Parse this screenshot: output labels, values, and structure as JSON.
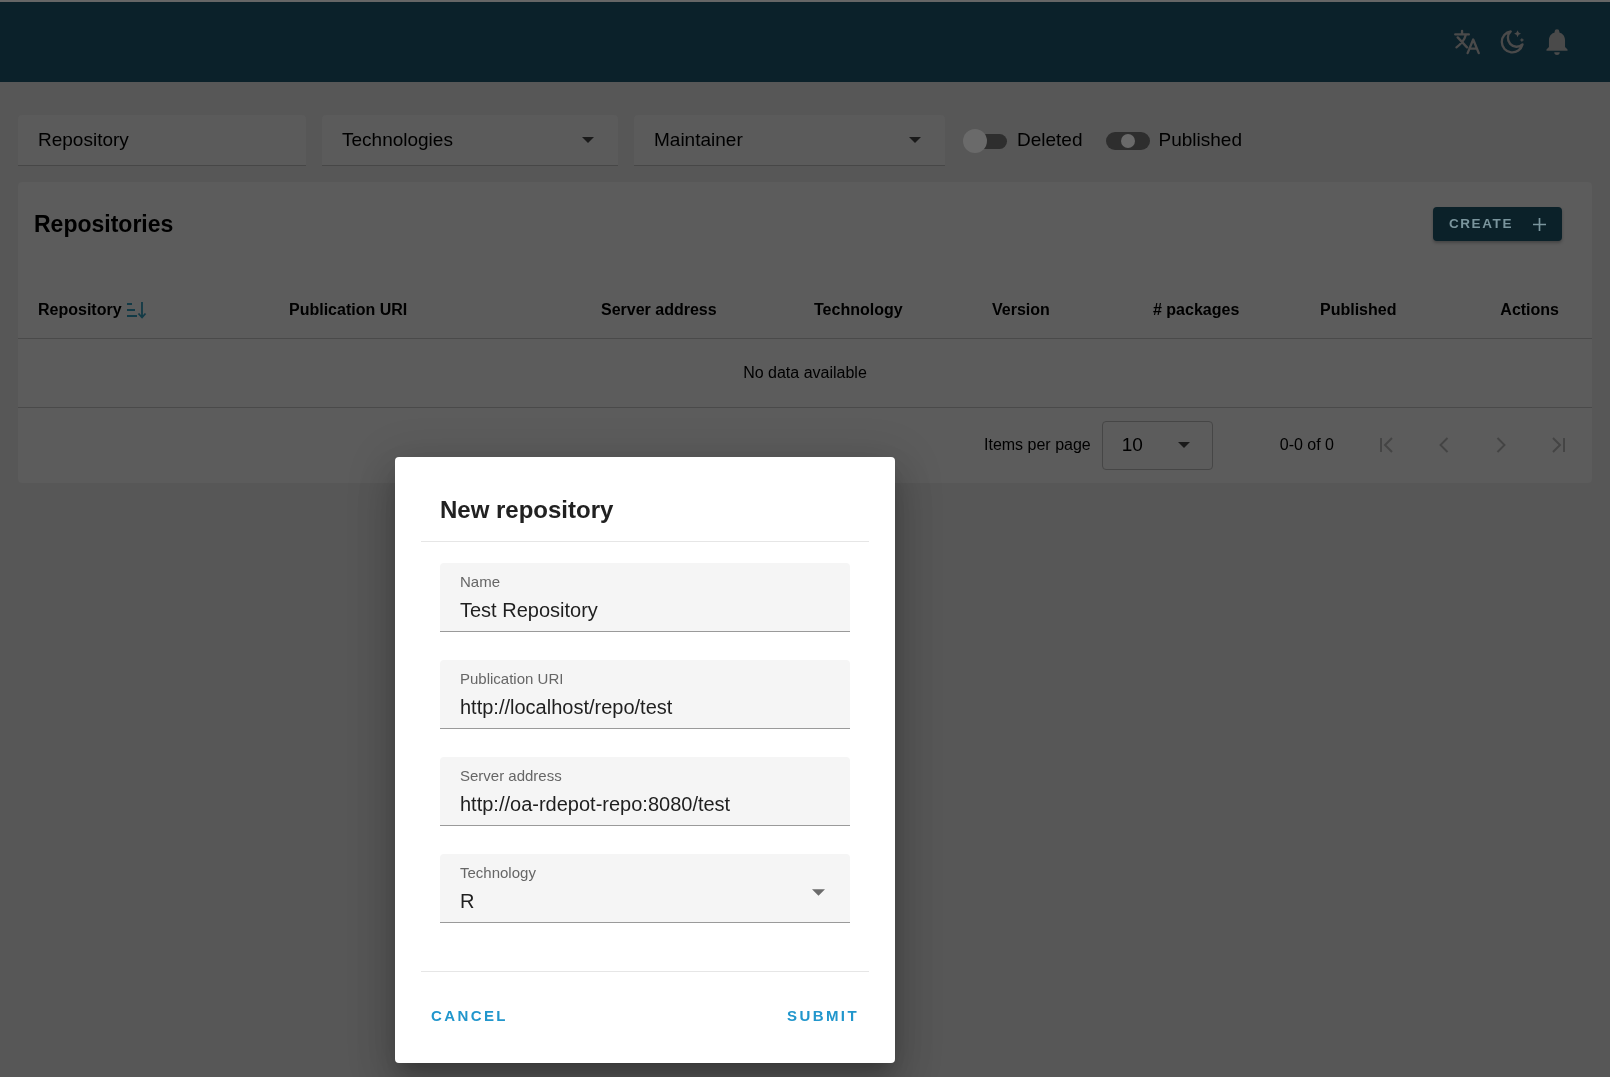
{
  "filters": {
    "fields": [
      {
        "kind": "input",
        "placeholder": "Repository"
      },
      {
        "kind": "select",
        "placeholder": "Technologies"
      },
      {
        "kind": "select",
        "placeholder": "Maintainer"
      }
    ],
    "toggles": [
      {
        "label": "Deleted",
        "on": false,
        "indeterminate": false
      },
      {
        "label": "Published",
        "on": false,
        "indeterminate": true
      }
    ]
  },
  "card": {
    "title": "Repositories",
    "create_button": "CREATE"
  },
  "table": {
    "columns": [
      {
        "label": "Repository",
        "sorted": true
      },
      {
        "label": "Publication URI",
        "sorted": false
      },
      {
        "label": "Server address",
        "sorted": false
      },
      {
        "label": "Technology",
        "sorted": false
      },
      {
        "label": "Version",
        "sorted": false
      },
      {
        "label": "# packages",
        "sorted": false
      },
      {
        "label": "Published",
        "sorted": false
      },
      {
        "label": "Actions",
        "sorted": false
      }
    ],
    "empty_text": "No data available"
  },
  "pagination": {
    "items_per_page_label": "Items per page",
    "items_per_page": "10",
    "range": "0-0 of 0",
    "nav_buttons": [
      {
        "kind": "first",
        "disabled": true
      },
      {
        "kind": "previous",
        "disabled": true
      },
      {
        "kind": "next",
        "disabled": true
      },
      {
        "kind": "last",
        "disabled": true
      }
    ]
  },
  "dialog": {
    "title": "New repository",
    "fields": [
      {
        "kind": "text",
        "label": "Name",
        "value": "Test Repository"
      },
      {
        "kind": "text",
        "label": "Publication URI",
        "value": "http://localhost/repo/test"
      },
      {
        "kind": "text",
        "label": "Server address",
        "value": "http://oa-rdepot-repo:8080/test"
      },
      {
        "kind": "select",
        "label": "Technology",
        "value": "R"
      }
    ],
    "buttons": [
      "CANCEL",
      "SUBMIT"
    ]
  }
}
